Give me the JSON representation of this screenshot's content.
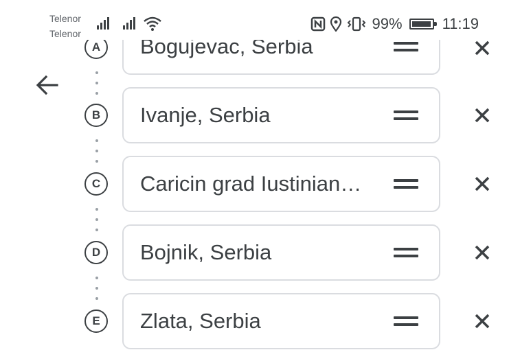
{
  "status_bar": {
    "carriers": [
      "Telenor",
      "Telenor"
    ],
    "battery_percent": "99%",
    "battery_level": 0.99,
    "time": "11:19",
    "icons": [
      "signal-icon",
      "signal-icon",
      "wifi-icon",
      "nfc-icon",
      "location-icon",
      "vibrate-icon",
      "battery-icon"
    ]
  },
  "nav": {
    "back_icon": "arrow-left-icon"
  },
  "waypoints": [
    {
      "letter": "A",
      "name": "Bogujevac, Serbia"
    },
    {
      "letter": "B",
      "name": "Ivanje, Serbia"
    },
    {
      "letter": "C",
      "name": "Caricin grad Iustinian…"
    },
    {
      "letter": "D",
      "name": "Bojnik, Serbia"
    },
    {
      "letter": "E",
      "name": "Zlata, Serbia"
    }
  ],
  "row_icons": {
    "drag": "drag-handle-icon",
    "remove": "close-icon"
  },
  "colors": {
    "text": "#3c4043",
    "field_border": "#dadce0",
    "dots": "#9aa0a6"
  }
}
